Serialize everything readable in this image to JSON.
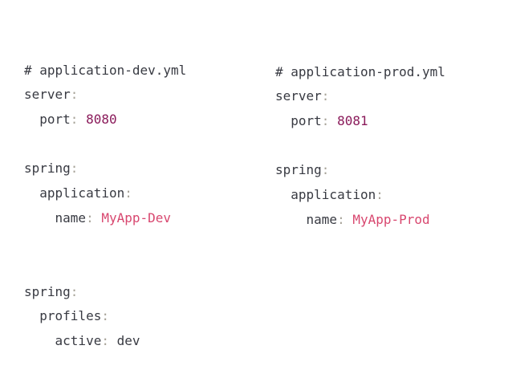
{
  "dev_file": {
    "comment": "# application-dev.yml",
    "server_key": "server",
    "port_key": "port",
    "port_value": "8080",
    "spring_key": "spring",
    "application_key": "application",
    "name_key": "name",
    "name_value": "MyApp-Dev"
  },
  "prod_file": {
    "comment": "# application-prod.yml",
    "server_key": "server",
    "port_key": "port",
    "port_value": "8081",
    "spring_key": "spring",
    "application_key": "application",
    "name_key": "name",
    "name_value": "MyApp-Prod"
  },
  "main_file": {
    "spring_key": "spring",
    "profiles_key": "profiles",
    "active_key": "active",
    "active_value": "dev"
  },
  "colors": {
    "background": "#ffffff",
    "text": "#383a42",
    "punctuation": "#a8a49a",
    "number": "#8a1a5a",
    "string": "#d8476f"
  }
}
